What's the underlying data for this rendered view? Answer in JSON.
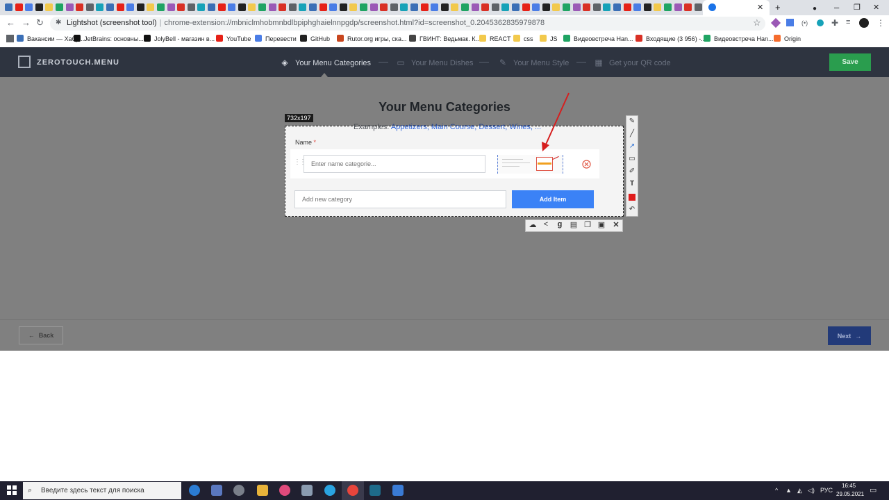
{
  "browser": {
    "url_title": "Lightshot (screenshot tool)",
    "url_path": "chrome-extension://mbniclmhobmnbdlbpiphghaielnnpgdp/screenshot.html?id=screenshot_0.2045362835979878",
    "new_tab_label": "+",
    "minimize_label": "–",
    "maximize_label": "❐",
    "close_label": "✕",
    "bookmarks": [
      {
        "label": "Вакансии — Хабр...",
        "color": "#3b6fb6"
      },
      {
        "label": "JetBrains: основны...",
        "color": "#111111"
      },
      {
        "label": "JolyBell - магазин в...",
        "color": "#111111"
      },
      {
        "label": "YouTube",
        "color": "#e62117"
      },
      {
        "label": "Перевести",
        "color": "#4a7de6"
      },
      {
        "label": "GitHub",
        "color": "#222222"
      },
      {
        "label": "Rutor.org игры, ска...",
        "color": "#c8461e"
      },
      {
        "label": "ГВИНТ: Ведьмак. К...",
        "color": "#444444"
      },
      {
        "label": "REACT",
        "color": "#f2c94c"
      },
      {
        "label": "css",
        "color": "#f2c94c"
      },
      {
        "label": "JS",
        "color": "#f2c94c"
      },
      {
        "label": "Видеовстреча Han...",
        "color": "#1fa463"
      },
      {
        "label": "Входящие (3 956) -...",
        "color": "#d93025"
      },
      {
        "label": "Видеовстреча Han...",
        "color": "#1fa463"
      },
      {
        "label": "Origin",
        "color": "#f56c2d"
      }
    ]
  },
  "app": {
    "logo": "ZEROTOUCH.MENU",
    "steps": [
      {
        "label": "Your Menu Categories"
      },
      {
        "label": "Your Menu Dishes"
      },
      {
        "label": "Your Menu Style"
      },
      {
        "label": "Get your QR code"
      }
    ],
    "save_label": "Save",
    "page_title": "Your Menu Categories",
    "examples_prefix": "Examples:",
    "examples_links": "Appetizers, Main Course, Dessert, Wines, ...",
    "back_label": "Back",
    "next_label": "Next"
  },
  "lightshot": {
    "size_label": "732x197",
    "name_label": "Name",
    "required_mark": "*",
    "name_placeholder": "Enter name categorie...",
    "new_category_placeholder": "Add new category",
    "add_item_label": "Add Item",
    "pen_color": "#e01c1c"
  },
  "taskbar": {
    "search_text": "Введите здесь текст для поиска",
    "language": "РУС",
    "time": "16:45",
    "date": "29.05.2021"
  }
}
